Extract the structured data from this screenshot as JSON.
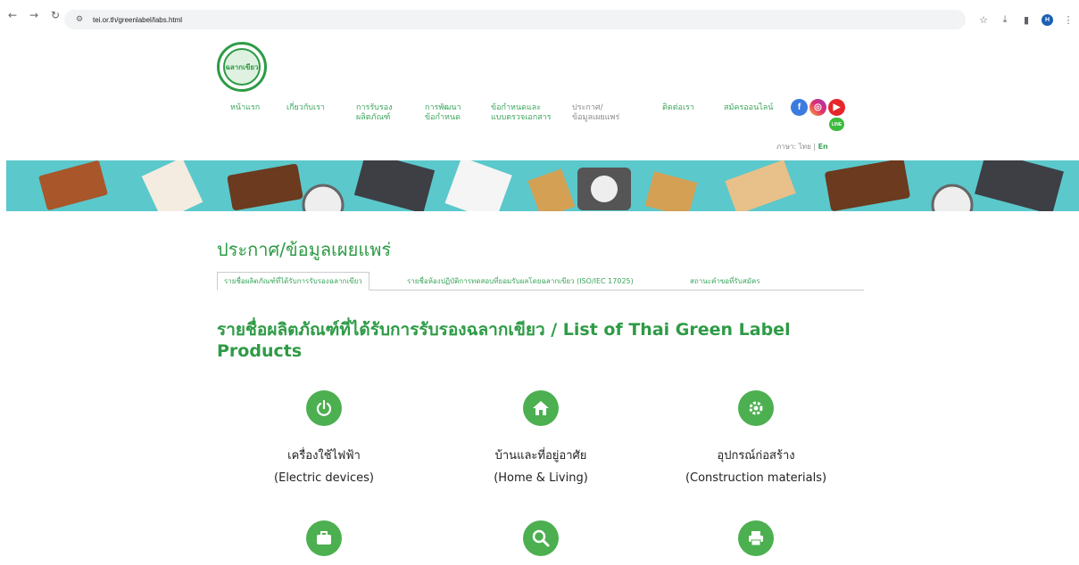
{
  "browser": {
    "url": "tei.or.th/greenlabel/labs.html",
    "avatar_letter": "H"
  },
  "logo": {
    "text": "ฉลากเขียว"
  },
  "nav": {
    "items": [
      {
        "line1": "หน้าแรก",
        "line2": ""
      },
      {
        "line1": "เกี่ยวกับเรา",
        "line2": ""
      },
      {
        "line1": "การรับรอง",
        "line2": "ผลิตภัณฑ์"
      },
      {
        "line1": "การพัฒนา",
        "line2": "ข้อกำหนด"
      },
      {
        "line1": "ข้อกำหนดและ",
        "line2": "แบบตรวจเอกสาร"
      },
      {
        "line1": "ประกาศ/",
        "line2": "ข้อมูลเผยแพร่"
      },
      {
        "line1": "ติดต่อเรา",
        "line2": ""
      },
      {
        "line1": "สมัครออนไลน์",
        "line2": ""
      }
    ],
    "line_label": "LINE",
    "lang_label": "ภาษา:",
    "lang_th": "ไทย",
    "lang_sep": "|",
    "lang_en": "En"
  },
  "page": {
    "title": "ประกาศ/ข้อมูลเผยแพร่",
    "tabs": [
      "รายชื่อผลิตภัณฑ์ที่ได้รับการรับรองฉลากเขียว",
      "รายชื่อห้องปฏิบัติการทดสอบที่ยอมรับผลโดยฉลากเขียว (ISO/IEC 17025)",
      "สถานะคำขอที่รับสมัคร"
    ],
    "list_title": "รายชื่อผลิตภัณฑ์ที่ได้รับการรับรองฉลากเขียว / List of Thai Green Label Products"
  },
  "categories": [
    {
      "th": "เครื่องใช้ไฟฟ้า",
      "en": "(Electric devices)",
      "icon": "power-icon"
    },
    {
      "th": "บ้านและที่อยู่อาศัย",
      "en": "(Home & Living)",
      "icon": "home-icon"
    },
    {
      "th": "อุปกรณ์ก่อสร้าง",
      "en": "(Construction materials)",
      "icon": "gear-icon"
    },
    {
      "th": "",
      "en": "",
      "icon": "briefcase-icon"
    },
    {
      "th": "",
      "en": "",
      "icon": "search-icon"
    },
    {
      "th": "",
      "en": "",
      "icon": "printer-icon"
    }
  ],
  "colors": {
    "brand_green": "#2e9b46",
    "banner_teal": "#5bc8cc"
  }
}
